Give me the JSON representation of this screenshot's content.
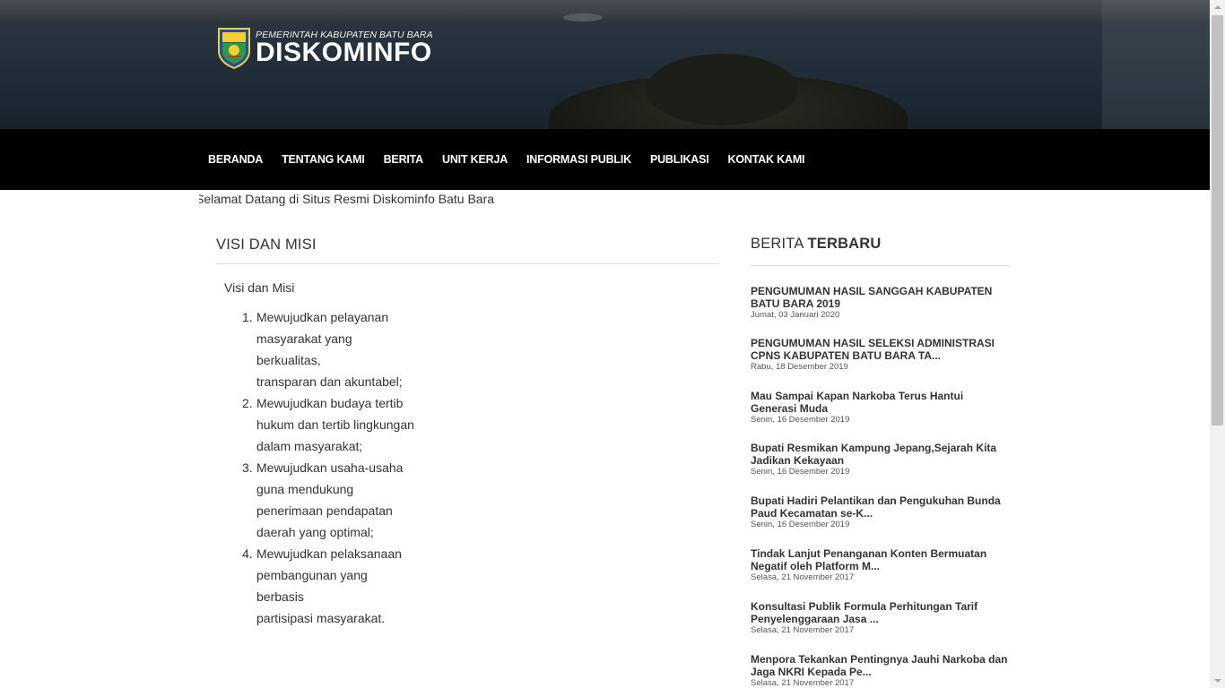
{
  "header": {
    "logo_small": "PEMERINTAH KABUPATEN BATU BARA",
    "logo_big": "DISKOMINFO",
    "emblem_text": "BATU BARA"
  },
  "nav": {
    "items": [
      {
        "label": "BERANDA"
      },
      {
        "label": "TENTANG KAMI"
      },
      {
        "label": "BERITA"
      },
      {
        "label": "UNIT KERJA"
      },
      {
        "label": "INFORMASI PUBLIK"
      },
      {
        "label": "PUBLIKASI"
      },
      {
        "label": "KONTAK KAMI"
      }
    ]
  },
  "marquee": {
    "text": "Selamat Datang di Situs Resmi Diskominfo Batu Bara"
  },
  "main": {
    "title": "VISI DAN MISI",
    "lead": "Visi dan Misi",
    "items": [
      {
        "num": "1.",
        "lines": [
          "Mewujudkan pelayanan",
          "masyarakat yang berkualitas,",
          "transparan dan akuntabel;"
        ]
      },
      {
        "num": "2.",
        "lines": [
          "Mewujudkan budaya tertib",
          "hukum dan tertib lingkungan",
          "dalam masyarakat;"
        ]
      },
      {
        "num": "3.",
        "lines": [
          "Mewujudkan usaha-usaha",
          "guna mendukung",
          "penerimaan pendapatan",
          "daerah yang optimal;"
        ]
      },
      {
        "num": "4.",
        "lines": [
          "Mewujudkan pelaksanaan",
          "pembangunan yang berbasis",
          "partisipasi masyarakat."
        ]
      }
    ]
  },
  "sidebar": {
    "title_light": "BERITA",
    "title_bold": "TERBARU",
    "news": [
      {
        "title": "PENGUMUMAN HASIL SANGGAH KABUPATEN BATU BARA 2019",
        "date": "Jumat, 03 Januari 2020"
      },
      {
        "title": "PENGUMUMAN HASIL SELEKSI ADMINISTRASI CPNS KABUPATEN BATU BARA TA...",
        "date": "Rabu, 18 Desember 2019"
      },
      {
        "title": "Mau Sampai Kapan Narkoba Terus Hantui Generasi Muda",
        "date": "Senin, 16 Desember 2019"
      },
      {
        "title": "Bupati Resmikan Kampung Jepang,Sejarah Kita Jadikan Kekayaan",
        "date": "Senin, 16 Desember 2019"
      },
      {
        "title": "Bupati Hadiri Pelantikan dan Pengukuhan Bunda Paud Kecamatan se-K...",
        "date": "Senin, 16 Desember 2019"
      },
      {
        "title": "Tindak Lanjut Penanganan Konten Bermuatan Negatif oleh Platform M...",
        "date": "Selasa, 21 November 2017"
      },
      {
        "title": "Konsultasi Publik Formula Perhitungan Tarif Penyelenggaraan Jasa ...",
        "date": "Selasa, 21 November 2017"
      },
      {
        "title": "Menpora Tekankan Pentingnya Jauhi Narkoba dan Jaga NKRI Kepada Pe...",
        "date": "Selasa, 21 November 2017"
      }
    ]
  },
  "colors": {
    "nav_bg": "#000000",
    "banner_bg": "#1c2833",
    "text": "#333333"
  }
}
